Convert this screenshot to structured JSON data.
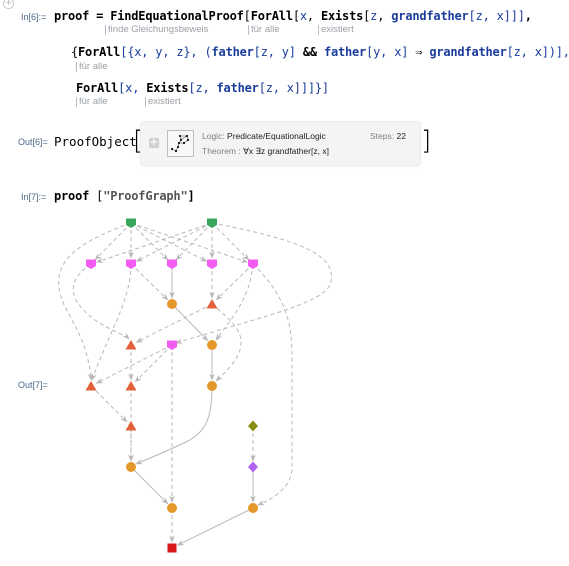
{
  "cells": {
    "add_cell_icon": "plus-icon",
    "in6": {
      "label": "In[6]:=",
      "line1": {
        "var": "proof",
        "eq": " = ",
        "fn": "FindEquationalProof",
        "open": "[",
        "forall": "ForAll",
        "b1": "[",
        "x": "x",
        "comma": ", ",
        "exists": "Exists",
        "b2": "[",
        "z": "z",
        "comma2": ", ",
        "grandfather": "grandfather",
        "args": "[z, x]]]",
        "tail": ","
      },
      "line1_hints": [
        "finde Gleichungsbeweis",
        "für alle",
        "existiert"
      ],
      "line2": {
        "open": "{",
        "forall": "ForAll",
        "vars": "[{x, y, z}, (",
        "father1": "father",
        "a1": "[z, y]",
        "and": " && ",
        "father2": "father",
        "a2": "[y, x]",
        "implies": " ⇒ ",
        "grandfather": "grandfather",
        "a3": "[z, x])],"
      },
      "line2_hints": [
        "für alle"
      ],
      "line3": {
        "forall": "ForAll",
        "b1": "[x, ",
        "exists": "Exists",
        "b2": "[z, ",
        "father": "father",
        "a": "[z, x]]]}]"
      },
      "line3_hints": [
        "für alle",
        "existiert"
      ]
    },
    "out6": {
      "label": "Out[6]=",
      "head": "ProofObject",
      "expand_icon": "plus-icon",
      "thumbnail_icon": "proof-graph-thumbnail-icon",
      "logic_key": "Logic: ",
      "logic_val": "Predicate/EquationalLogic",
      "steps_key": "Steps: ",
      "steps_val": "22",
      "theorem_key": "Theorem : ",
      "theorem_val": "∀x ∃z grandfather[z, x]"
    },
    "in7": {
      "label": "In[7]:=",
      "var": "proof",
      "arg_open": " [",
      "arg": "\"ProofGraph\"",
      "arg_close": "]"
    },
    "out7": {
      "label": "Out[7]="
    }
  },
  "graph": {
    "colors": {
      "axiom": "#3aa85c",
      "hypothesis": "#f25cf0",
      "substitution": "#e5982a",
      "critical_pair": "#e2603a",
      "olive": "#8a8e10",
      "purple": "#b063f2",
      "conclusion": "#d81a1a",
      "edge": "#b8b8b8"
    },
    "nodes": [
      {
        "id": "a1",
        "shape": "pentagon",
        "kind": "axiom"
      },
      {
        "id": "a2",
        "shape": "pentagon",
        "kind": "axiom"
      },
      {
        "id": "h1",
        "shape": "pentagon",
        "kind": "hypothesis"
      },
      {
        "id": "h2",
        "shape": "pentagon",
        "kind": "hypothesis"
      },
      {
        "id": "h3",
        "shape": "pentagon",
        "kind": "hypothesis"
      },
      {
        "id": "h4",
        "shape": "pentagon",
        "kind": "hypothesis"
      },
      {
        "id": "h5",
        "shape": "pentagon",
        "kind": "hypothesis"
      },
      {
        "id": "c1",
        "shape": "circle",
        "kind": "substitution"
      },
      {
        "id": "t1",
        "shape": "triangle",
        "kind": "critical_pair"
      },
      {
        "id": "t2",
        "shape": "triangle",
        "kind": "critical_pair"
      },
      {
        "id": "h6",
        "shape": "pentagon",
        "kind": "hypothesis"
      },
      {
        "id": "c2",
        "shape": "circle",
        "kind": "substitution"
      },
      {
        "id": "t3",
        "shape": "triangle",
        "kind": "critical_pair"
      },
      {
        "id": "t4",
        "shape": "triangle",
        "kind": "critical_pair"
      },
      {
        "id": "c3",
        "shape": "circle",
        "kind": "substitution"
      },
      {
        "id": "t5",
        "shape": "triangle",
        "kind": "critical_pair"
      },
      {
        "id": "d1",
        "shape": "diamond",
        "kind": "olive"
      },
      {
        "id": "c4",
        "shape": "circle",
        "kind": "substitution"
      },
      {
        "id": "d2",
        "shape": "diamond",
        "kind": "purple"
      },
      {
        "id": "c5",
        "shape": "circle",
        "kind": "substitution"
      },
      {
        "id": "c6",
        "shape": "circle",
        "kind": "substitution"
      },
      {
        "id": "q",
        "shape": "square",
        "kind": "conclusion"
      }
    ],
    "edges": [
      {
        "from": "a1",
        "to": "h1",
        "style": "dashed"
      },
      {
        "from": "a1",
        "to": "h2",
        "style": "dashed"
      },
      {
        "from": "a1",
        "to": "h3",
        "style": "dashed"
      },
      {
        "from": "a1",
        "to": "h4",
        "style": "dashed"
      },
      {
        "from": "a1",
        "to": "h5",
        "style": "dashed"
      },
      {
        "from": "a2",
        "to": "h1",
        "style": "dashed"
      },
      {
        "from": "a2",
        "to": "h2",
        "style": "dashed"
      },
      {
        "from": "a2",
        "to": "h3",
        "style": "dashed"
      },
      {
        "from": "a2",
        "to": "h4",
        "style": "dashed"
      },
      {
        "from": "a2",
        "to": "h5",
        "style": "dashed"
      },
      {
        "from": "a1",
        "to": "t3",
        "style": "dashed"
      },
      {
        "from": "a2",
        "to": "h6",
        "style": "dashed"
      },
      {
        "from": "h3",
        "to": "c1",
        "style": "solid"
      },
      {
        "from": "h2",
        "to": "c1",
        "style": "dashed"
      },
      {
        "from": "h4",
        "to": "t1",
        "style": "dashed"
      },
      {
        "from": "h5",
        "to": "t1",
        "style": "dashed"
      },
      {
        "from": "h1",
        "to": "t2",
        "style": "dashed"
      },
      {
        "from": "h2",
        "to": "t3",
        "style": "dashed"
      },
      {
        "from": "t1",
        "to": "t2",
        "style": "dashed"
      },
      {
        "from": "c1",
        "to": "c2",
        "style": "solid"
      },
      {
        "from": "h5",
        "to": "c2",
        "style": "dashed"
      },
      {
        "from": "t1",
        "to": "c3",
        "style": "dashed"
      },
      {
        "from": "c2",
        "to": "c3",
        "style": "solid"
      },
      {
        "from": "h6",
        "to": "t3",
        "style": "dashed"
      },
      {
        "from": "h6",
        "to": "t4",
        "style": "dashed"
      },
      {
        "from": "t2",
        "to": "t4",
        "style": "dashed"
      },
      {
        "from": "t3",
        "to": "t5",
        "style": "dashed"
      },
      {
        "from": "t4",
        "to": "c4",
        "style": "dashed"
      },
      {
        "from": "t5",
        "to": "c4",
        "style": "dashed"
      },
      {
        "from": "c3",
        "to": "c4",
        "style": "solid"
      },
      {
        "from": "d1",
        "to": "d2",
        "style": "dashed"
      },
      {
        "from": "d2",
        "to": "c6",
        "style": "solid"
      },
      {
        "from": "h5",
        "to": "c6",
        "style": "dashed"
      },
      {
        "from": "c4",
        "to": "c5",
        "style": "solid"
      },
      {
        "from": "h6",
        "to": "c5",
        "style": "dashed"
      },
      {
        "from": "c5",
        "to": "q",
        "style": "dashed"
      },
      {
        "from": "c6",
        "to": "q",
        "style": "solid"
      }
    ]
  }
}
